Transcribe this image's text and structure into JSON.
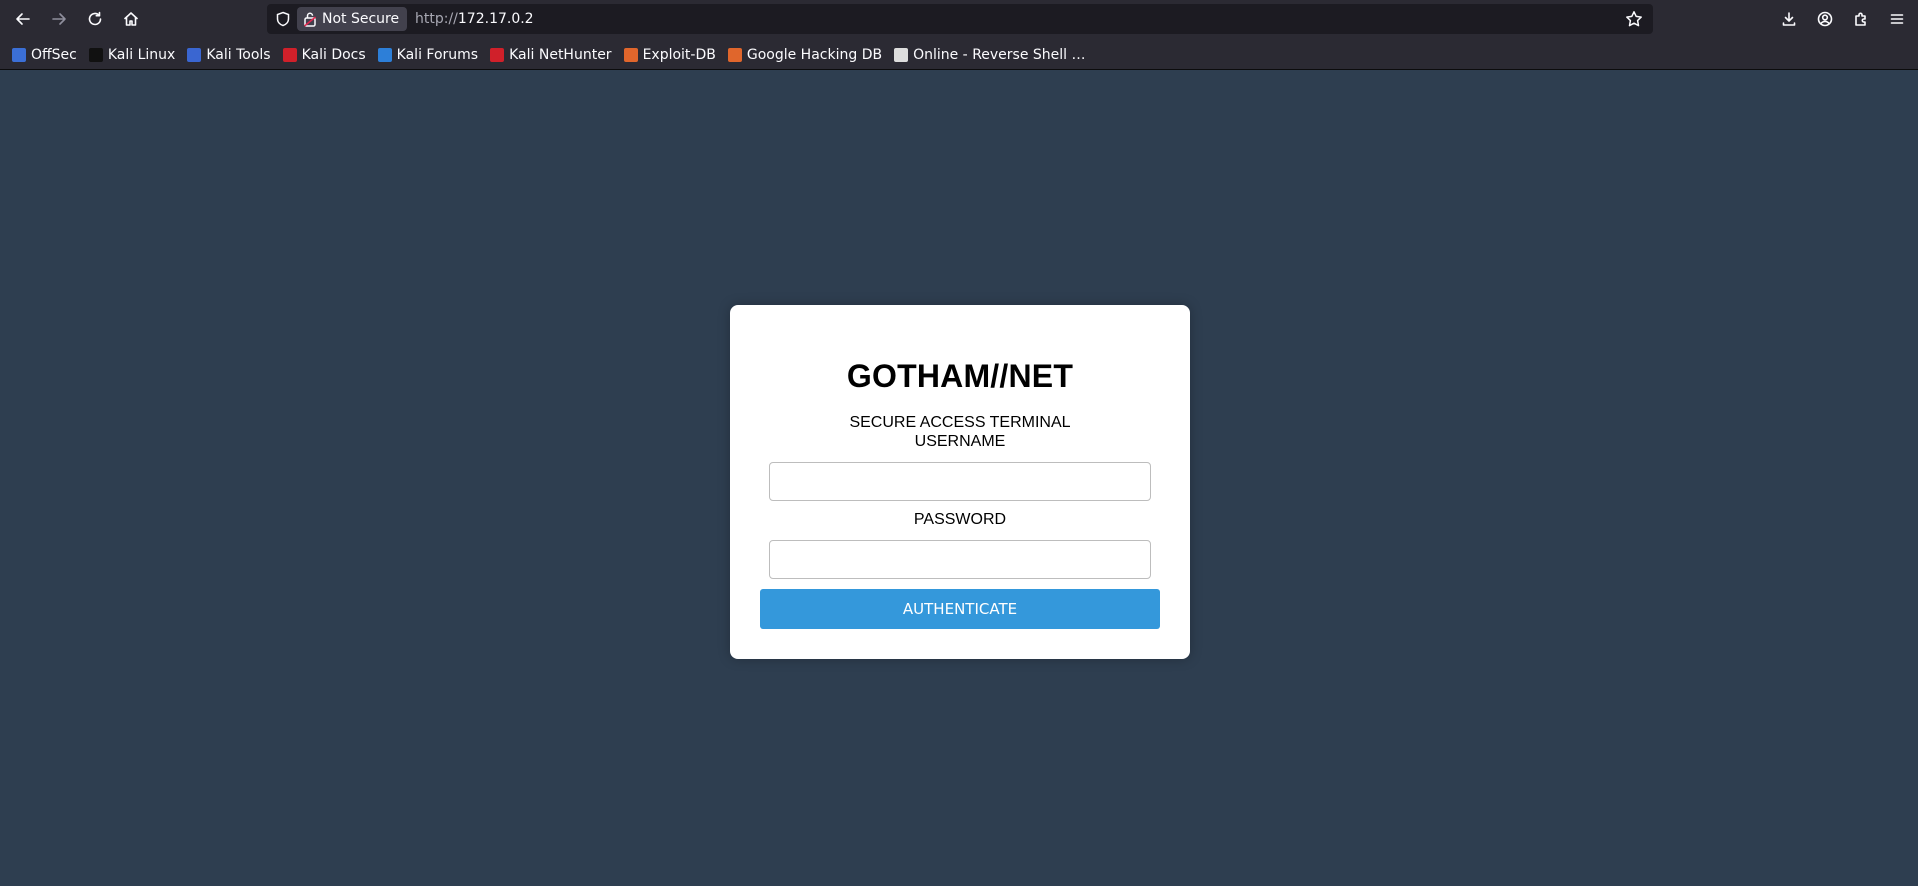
{
  "browser": {
    "url_protocol": "http://",
    "url_host": "172.17.0.2",
    "security_label": "Not Secure"
  },
  "bookmarks": [
    {
      "label": "OffSec",
      "icon": "offsec-icon",
      "color": "#3b6fd6"
    },
    {
      "label": "Kali Linux",
      "icon": "kali-dragon-icon",
      "color": "#111111"
    },
    {
      "label": "Kali Tools",
      "icon": "kali-tools-icon",
      "color": "#3a66d1"
    },
    {
      "label": "Kali Docs",
      "icon": "kali-docs-icon",
      "color": "#d0202a"
    },
    {
      "label": "Kali Forums",
      "icon": "kali-forums-icon",
      "color": "#2d7fd8"
    },
    {
      "label": "Kali NetHunter",
      "icon": "kali-nethunter-icon",
      "color": "#d0202a"
    },
    {
      "label": "Exploit-DB",
      "icon": "exploit-db-icon",
      "color": "#e0662c"
    },
    {
      "label": "Google Hacking DB",
      "icon": "ghdb-icon",
      "color": "#e0662c"
    },
    {
      "label": "Online - Reverse Shell …",
      "icon": "skull-icon",
      "color": "#dddddd"
    }
  ],
  "login": {
    "title": "GOTHAM//NET",
    "subtitle": "SECURE ACCESS TERMINAL",
    "username_label": "USERNAME",
    "username_value": "",
    "password_label": "PASSWORD",
    "password_value": "",
    "submit_label": "AUTHENTICATE"
  },
  "colors": {
    "page_background": "#2e3e50",
    "button": "#3498db"
  }
}
